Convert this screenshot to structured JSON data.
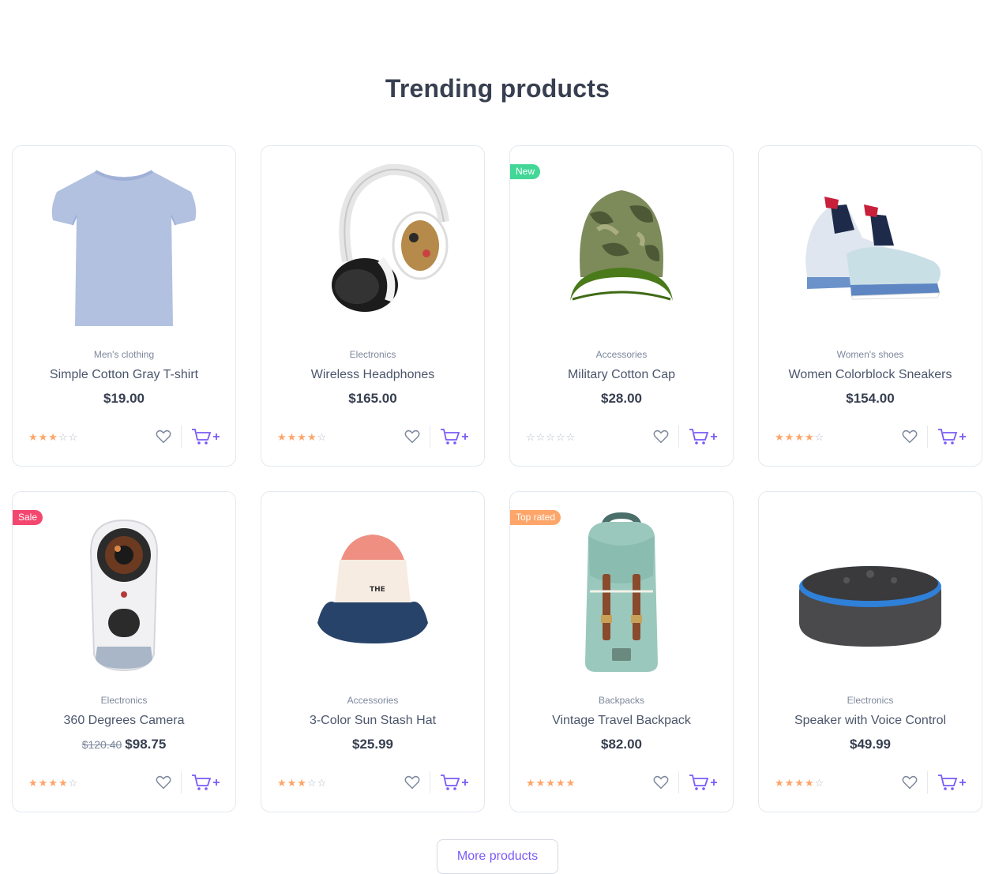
{
  "section": {
    "title": "Trending products"
  },
  "colors": {
    "accent": "#7a5af8",
    "star": "#fea569",
    "new": "#42d697",
    "sale": "#f34770",
    "top": "#fea569"
  },
  "products": [
    {
      "category": "Men's clothing",
      "name": "Simple Cotton Gray T-shirt",
      "price": "$19.00",
      "rating": 3,
      "badge": "",
      "image": "tshirt"
    },
    {
      "category": "Electronics",
      "name": "Wireless Headphones",
      "price": "$165.00",
      "rating": 4,
      "badge": "",
      "image": "headphones"
    },
    {
      "category": "Accessories",
      "name": "Military Cotton Cap",
      "price": "$28.00",
      "rating": 0,
      "badge": "New",
      "image": "cap"
    },
    {
      "category": "Women's shoes",
      "name": "Women Colorblock Sneakers",
      "price": "$154.00",
      "rating": 4,
      "badge": "",
      "image": "sneakers"
    },
    {
      "category": "Electronics",
      "name": "360 Degrees Camera",
      "price": "$98.75",
      "old_price": "$120.40",
      "rating": 4,
      "badge": "Sale",
      "image": "camera"
    },
    {
      "category": "Accessories",
      "name": "3-Color Sun Stash Hat",
      "price": "$25.99",
      "rating": 3,
      "badge": "",
      "image": "bucket-hat"
    },
    {
      "category": "Backpacks",
      "name": "Vintage Travel Backpack",
      "price": "$82.00",
      "rating": 5,
      "badge": "Top rated",
      "image": "backpack"
    },
    {
      "category": "Electronics",
      "name": "Speaker with Voice Control",
      "price": "$49.99",
      "rating": 4,
      "badge": "",
      "image": "smart-speaker"
    }
  ],
  "more_button": "More products"
}
